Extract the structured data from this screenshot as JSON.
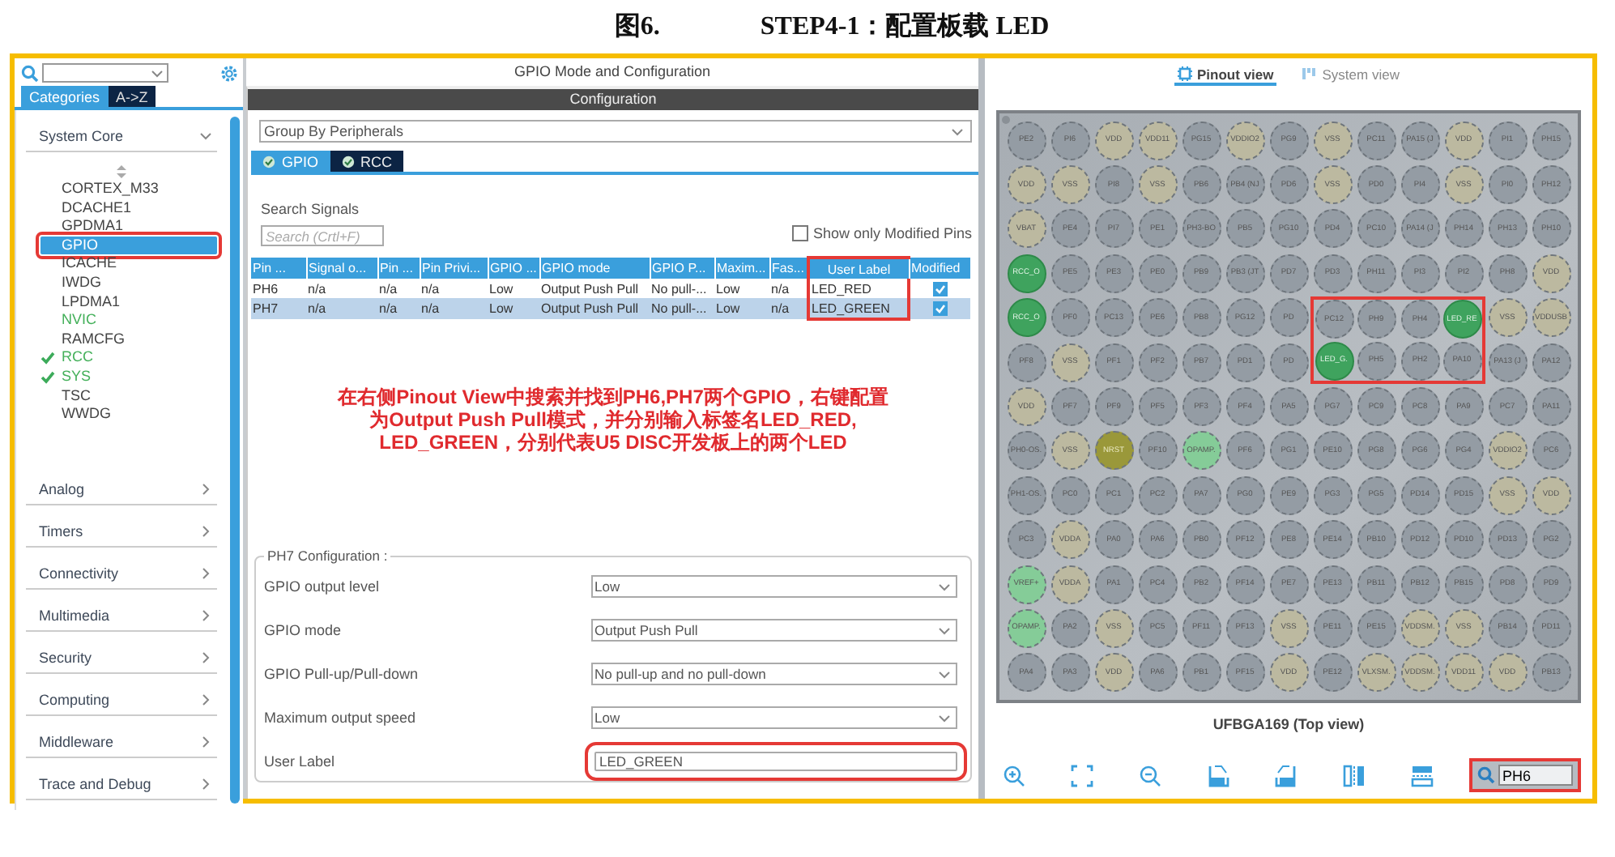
{
  "caption": {
    "number": "图6.",
    "text": "STEP4-1：配置板载 LED"
  },
  "left_panel": {
    "tabs": [
      {
        "label": "Categories",
        "selected": true
      },
      {
        "label": "A->Z",
        "selected": false
      }
    ],
    "categories": [
      {
        "label": "System Core",
        "expanded": true,
        "items": [
          {
            "label": "CORTEX_M33",
            "selected": false,
            "enabled": false,
            "checked": false
          },
          {
            "label": "DCACHE1",
            "selected": false,
            "enabled": false,
            "checked": false
          },
          {
            "label": "GPDMA1",
            "selected": false,
            "enabled": false,
            "checked": false
          },
          {
            "label": "GPIO",
            "selected": true,
            "enabled": false,
            "checked": false,
            "highlight": true
          },
          {
            "label": "ICACHE",
            "selected": false,
            "enabled": false,
            "checked": false
          },
          {
            "label": "IWDG",
            "selected": false,
            "enabled": false,
            "checked": false
          },
          {
            "label": "LPDMA1",
            "selected": false,
            "enabled": false,
            "checked": false
          },
          {
            "label": "NVIC",
            "selected": false,
            "enabled": true,
            "checked": false
          },
          {
            "label": "RAMCFG",
            "selected": false,
            "enabled": false,
            "checked": false
          },
          {
            "label": "RCC",
            "selected": false,
            "enabled": true,
            "checked": true
          },
          {
            "label": "SYS",
            "selected": false,
            "enabled": true,
            "checked": true
          },
          {
            "label": "TSC",
            "selected": false,
            "enabled": false,
            "checked": false
          },
          {
            "label": "WWDG",
            "selected": false,
            "enabled": false,
            "checked": false
          }
        ]
      },
      {
        "label": "Analog",
        "expanded": false
      },
      {
        "label": "Timers",
        "expanded": false
      },
      {
        "label": "Connectivity",
        "expanded": false
      },
      {
        "label": "Multimedia",
        "expanded": false
      },
      {
        "label": "Security",
        "expanded": false
      },
      {
        "label": "Computing",
        "expanded": false
      },
      {
        "label": "Middleware",
        "expanded": false
      },
      {
        "label": "Trace and Debug",
        "expanded": false
      }
    ]
  },
  "middle_panel": {
    "title": "GPIO Mode and Configuration",
    "section": "Configuration",
    "group_by": "Group By Peripherals",
    "tabs": [
      {
        "label": "GPIO",
        "selected": true
      },
      {
        "label": "RCC",
        "selected": false
      }
    ],
    "search_label": "Search Signals",
    "search": {
      "placeholder": "Search (Crtl+F)"
    },
    "modified_only": {
      "label": "Show only Modified Pins",
      "checked": false
    },
    "table": {
      "columns": [
        {
          "label": "Pin ..."
        },
        {
          "label": "Signal o..."
        },
        {
          "label": "Pin ..."
        },
        {
          "label": "Pin Privi..."
        },
        {
          "label": "GPIO ..."
        },
        {
          "label": "GPIO mode"
        },
        {
          "label": "GPIO P..."
        },
        {
          "label": "Maxim..."
        },
        {
          "label": "Fas..."
        },
        {
          "label": "User Label",
          "highlight": true
        },
        {
          "label": "Modified"
        }
      ],
      "rows": [
        {
          "selected": false,
          "modified": true,
          "cells": [
            "PH6",
            "n/a",
            "n/a",
            "n/a",
            "Low",
            "Output Push Pull",
            "No pull-...",
            "Low",
            "n/a",
            "LED_RED"
          ]
        },
        {
          "selected": true,
          "modified": true,
          "cells": [
            "PH7",
            "n/a",
            "n/a",
            "n/a",
            "Low",
            "Output Push Pull",
            "No pull-...",
            "Low",
            "n/a",
            "LED_GREEN"
          ]
        }
      ]
    },
    "annotation": [
      "在右侧Pinout View中搜索并找到PH6,PH7两个GPIO，右键配置",
      "为Output Push Pull模式，并分别输入标签名LED_RED,",
      "LED_GREEN，分别代表U5 DISC开发板上的两个LED"
    ],
    "pin_config": {
      "title": "PH7 Configuration :",
      "fields": [
        {
          "label": "GPIO output level",
          "value": "Low",
          "kind": "select"
        },
        {
          "label": "GPIO mode",
          "value": "Output Push Pull",
          "kind": "select"
        },
        {
          "label": "GPIO Pull-up/Pull-down",
          "value": "No pull-up and no pull-down",
          "kind": "select"
        },
        {
          "label": "Maximum output speed",
          "value": "Low",
          "kind": "select"
        },
        {
          "label": "User Label",
          "value": "LED_GREEN",
          "kind": "text",
          "highlight": true
        }
      ]
    }
  },
  "right_panel": {
    "views": [
      {
        "label": "Pinout view",
        "selected": true
      },
      {
        "label": "System view",
        "selected": false
      }
    ],
    "pin_rows": [
      [
        {
          "label": "PE2",
          "kind": "io"
        },
        {
          "label": "PI6",
          "kind": "io"
        },
        {
          "label": "VDD",
          "kind": "power"
        },
        {
          "label": "VDD11",
          "kind": "power"
        },
        {
          "label": "PG15",
          "kind": "io"
        },
        {
          "label": "VDDIO2",
          "kind": "power"
        },
        {
          "label": "PG9",
          "kind": "io"
        },
        {
          "label": "VSS",
          "kind": "power"
        },
        {
          "label": "PC11",
          "kind": "io"
        },
        {
          "label": "PA15 (J",
          "kind": "io"
        },
        {
          "label": "VDD",
          "kind": "power"
        },
        {
          "label": "PI1",
          "kind": "io"
        },
        {
          "label": "PH15",
          "kind": "io"
        }
      ],
      [
        {
          "label": "VDD",
          "kind": "power"
        },
        {
          "label": "VSS",
          "kind": "power"
        },
        {
          "label": "PI8",
          "kind": "io"
        },
        {
          "label": "VSS",
          "kind": "power"
        },
        {
          "label": "PB6",
          "kind": "io"
        },
        {
          "label": "PB4 (NJ",
          "kind": "io"
        },
        {
          "label": "PD6",
          "kind": "io"
        },
        {
          "label": "VSS",
          "kind": "power"
        },
        {
          "label": "PD0",
          "kind": "io"
        },
        {
          "label": "PI4",
          "kind": "io"
        },
        {
          "label": "VSS",
          "kind": "power"
        },
        {
          "label": "PI0",
          "kind": "io"
        },
        {
          "label": "PH12",
          "kind": "io"
        }
      ],
      [
        {
          "label": "VBAT",
          "kind": "power"
        },
        {
          "label": "PE4",
          "kind": "io"
        },
        {
          "label": "PI7",
          "kind": "io"
        },
        {
          "label": "PE1",
          "kind": "io"
        },
        {
          "label": "PH3-BO",
          "kind": "io"
        },
        {
          "label": "PB5",
          "kind": "io"
        },
        {
          "label": "PG10",
          "kind": "io"
        },
        {
          "label": "PD4",
          "kind": "io"
        },
        {
          "label": "PC10",
          "kind": "io"
        },
        {
          "label": "PA14 (J",
          "kind": "io"
        },
        {
          "label": "PH14",
          "kind": "io"
        },
        {
          "label": "PH13",
          "kind": "io"
        },
        {
          "label": "PH10",
          "kind": "io"
        }
      ],
      [
        {
          "label": "RCC_O",
          "kind": "assigned"
        },
        {
          "label": "PE5",
          "kind": "io"
        },
        {
          "label": "PE3",
          "kind": "io"
        },
        {
          "label": "PE0",
          "kind": "io"
        },
        {
          "label": "PB9",
          "kind": "io"
        },
        {
          "label": "PB3 (JT",
          "kind": "io"
        },
        {
          "label": "PD7",
          "kind": "io"
        },
        {
          "label": "PD3",
          "kind": "io"
        },
        {
          "label": "PH11",
          "kind": "io"
        },
        {
          "label": "PI3",
          "kind": "io"
        },
        {
          "label": "PI2",
          "kind": "io"
        },
        {
          "label": "PH8",
          "kind": "io"
        },
        {
          "label": "VDD",
          "kind": "power"
        }
      ],
      [
        {
          "label": "RCC_O",
          "kind": "assigned"
        },
        {
          "label": "PF0",
          "kind": "io"
        },
        {
          "label": "PC13",
          "kind": "io"
        },
        {
          "label": "PE6",
          "kind": "io"
        },
        {
          "label": "PB8",
          "kind": "io"
        },
        {
          "label": "PG12",
          "kind": "io"
        },
        {
          "label": "PD",
          "kind": "io"
        },
        {
          "label": "PC12",
          "kind": "io",
          "highlight": true
        },
        {
          "label": "PH9",
          "kind": "io",
          "highlight": true
        },
        {
          "label": "PH4",
          "kind": "io",
          "highlight": true
        },
        {
          "label": "LED_RE",
          "kind": "assigned",
          "highlight": true
        },
        {
          "label": "VSS",
          "kind": "power"
        },
        {
          "label": "VDDUSB",
          "kind": "power"
        }
      ],
      [
        {
          "label": "PF8",
          "kind": "io"
        },
        {
          "label": "VSS",
          "kind": "power"
        },
        {
          "label": "PF1",
          "kind": "io"
        },
        {
          "label": "PF2",
          "kind": "io"
        },
        {
          "label": "PB7",
          "kind": "io"
        },
        {
          "label": "PD1",
          "kind": "io"
        },
        {
          "label": "PD",
          "kind": "io"
        },
        {
          "label": "LED_G.",
          "kind": "assigned",
          "highlight": true
        },
        {
          "label": "PH5",
          "kind": "io",
          "highlight": true
        },
        {
          "label": "PH2",
          "kind": "io",
          "highlight": true
        },
        {
          "label": "PA10",
          "kind": "io",
          "highlight": true
        },
        {
          "label": "PA13 (J",
          "kind": "io"
        },
        {
          "label": "PA12",
          "kind": "io"
        }
      ],
      [
        {
          "label": "VDD",
          "kind": "power"
        },
        {
          "label": "PF7",
          "kind": "io"
        },
        {
          "label": "PF9",
          "kind": "io"
        },
        {
          "label": "PF5",
          "kind": "io"
        },
        {
          "label": "PF3",
          "kind": "io"
        },
        {
          "label": "PF4",
          "kind": "io"
        },
        {
          "label": "PA5",
          "kind": "io"
        },
        {
          "label": "PG7",
          "kind": "io"
        },
        {
          "label": "PC9",
          "kind": "io"
        },
        {
          "label": "PC8",
          "kind": "io"
        },
        {
          "label": "PA9",
          "kind": "io"
        },
        {
          "label": "PC7",
          "kind": "io"
        },
        {
          "label": "PA11",
          "kind": "io"
        }
      ],
      [
        {
          "label": "PH0-OS.",
          "kind": "io"
        },
        {
          "label": "VSS",
          "kind": "power"
        },
        {
          "label": "NRST",
          "kind": "reset"
        },
        {
          "label": "PF10",
          "kind": "io"
        },
        {
          "label": "OPAMP.",
          "kind": "analog"
        },
        {
          "label": "PF6",
          "kind": "io"
        },
        {
          "label": "PG1",
          "kind": "io"
        },
        {
          "label": "PE10",
          "kind": "io"
        },
        {
          "label": "PG8",
          "kind": "io"
        },
        {
          "label": "PG6",
          "kind": "io"
        },
        {
          "label": "PG4",
          "kind": "io"
        },
        {
          "label": "VDDIO2",
          "kind": "power"
        },
        {
          "label": "PC6",
          "kind": "io"
        }
      ],
      [
        {
          "label": "PH1-OS.",
          "kind": "io"
        },
        {
          "label": "PC0",
          "kind": "io"
        },
        {
          "label": "PC1",
          "kind": "io"
        },
        {
          "label": "PC2",
          "kind": "io"
        },
        {
          "label": "PA7",
          "kind": "io"
        },
        {
          "label": "PG0",
          "kind": "io"
        },
        {
          "label": "PE9",
          "kind": "io"
        },
        {
          "label": "PG3",
          "kind": "io"
        },
        {
          "label": "PG5",
          "kind": "io"
        },
        {
          "label": "PD14",
          "kind": "io"
        },
        {
          "label": "PD15",
          "kind": "io"
        },
        {
          "label": "VSS",
          "kind": "power"
        },
        {
          "label": "VDD",
          "kind": "power"
        }
      ],
      [
        {
          "label": "PC3",
          "kind": "io"
        },
        {
          "label": "VDDA",
          "kind": "power"
        },
        {
          "label": "PA0",
          "kind": "io"
        },
        {
          "label": "PA6",
          "kind": "io"
        },
        {
          "label": "PB0",
          "kind": "io"
        },
        {
          "label": "PF12",
          "kind": "io"
        },
        {
          "label": "PE8",
          "kind": "io"
        },
        {
          "label": "PE14",
          "kind": "io"
        },
        {
          "label": "PB10",
          "kind": "io"
        },
        {
          "label": "PD12",
          "kind": "io"
        },
        {
          "label": "PD10",
          "kind": "io"
        },
        {
          "label": "PD13",
          "kind": "io"
        },
        {
          "label": "PG2",
          "kind": "io"
        }
      ],
      [
        {
          "label": "VREF+",
          "kind": "analog"
        },
        {
          "label": "VDDA",
          "kind": "power"
        },
        {
          "label": "PA1",
          "kind": "io"
        },
        {
          "label": "PC4",
          "kind": "io"
        },
        {
          "label": "PB2",
          "kind": "io"
        },
        {
          "label": "PF14",
          "kind": "io"
        },
        {
          "label": "PE7",
          "kind": "io"
        },
        {
          "label": "PE13",
          "kind": "io"
        },
        {
          "label": "PB11",
          "kind": "io"
        },
        {
          "label": "PB12",
          "kind": "io"
        },
        {
          "label": "PB15",
          "kind": "io"
        },
        {
          "label": "PD8",
          "kind": "io"
        },
        {
          "label": "PD9",
          "kind": "io"
        }
      ],
      [
        {
          "label": "OPAMP.",
          "kind": "analog"
        },
        {
          "label": "PA2",
          "kind": "io"
        },
        {
          "label": "VSS",
          "kind": "power"
        },
        {
          "label": "PC5",
          "kind": "io"
        },
        {
          "label": "PF11",
          "kind": "io"
        },
        {
          "label": "PF13",
          "kind": "io"
        },
        {
          "label": "VSS",
          "kind": "power"
        },
        {
          "label": "PE11",
          "kind": "io"
        },
        {
          "label": "PE15",
          "kind": "io"
        },
        {
          "label": "VDDSM.",
          "kind": "power"
        },
        {
          "label": "VSS",
          "kind": "power"
        },
        {
          "label": "PB14",
          "kind": "io"
        },
        {
          "label": "PD11",
          "kind": "io"
        }
      ],
      [
        {
          "label": "PA4",
          "kind": "io"
        },
        {
          "label": "PA3",
          "kind": "io"
        },
        {
          "label": "VDD",
          "kind": "power"
        },
        {
          "label": "PA6",
          "kind": "io"
        },
        {
          "label": "PB1",
          "kind": "io"
        },
        {
          "label": "PF15",
          "kind": "io"
        },
        {
          "label": "VDD",
          "kind": "power"
        },
        {
          "label": "PE12",
          "kind": "io"
        },
        {
          "label": "VLXSM.",
          "kind": "power"
        },
        {
          "label": "VDDSM.",
          "kind": "power"
        },
        {
          "label": "VDD11",
          "kind": "power"
        },
        {
          "label": "VDD",
          "kind": "power"
        },
        {
          "label": "PB13",
          "kind": "io"
        }
      ]
    ],
    "package": "UFBGA169 (Top view)",
    "find": {
      "value": "PH6",
      "highlight": true
    }
  }
}
